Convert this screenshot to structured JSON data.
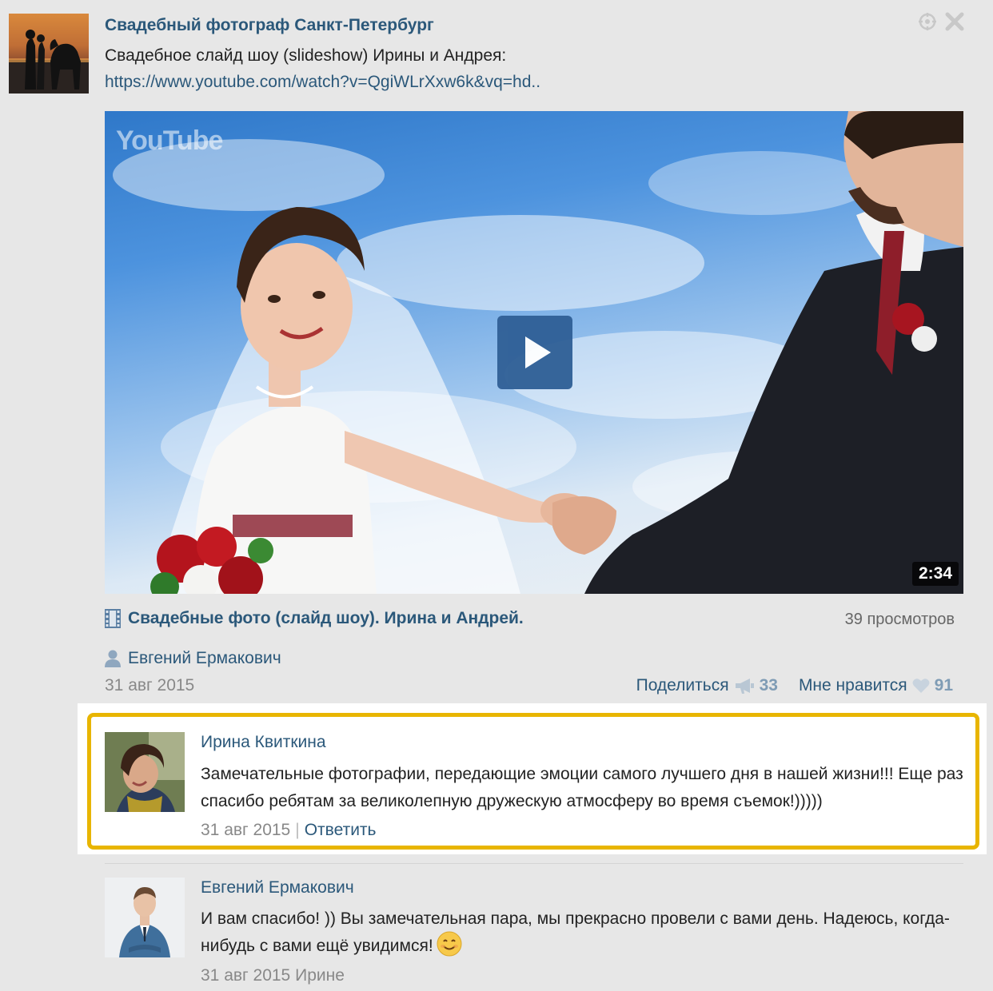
{
  "post": {
    "author": "Свадебный фотограф Санкт-Петербург",
    "text": "Свадебное слайд шоу (slideshow) Ирины и Андрея:",
    "url": "https://www.youtube.com/watch?v=QgiWLrXxw6k&vq=hd..",
    "date": "31 авг 2015",
    "header_icons": [
      "crosshair-icon",
      "close-icon"
    ]
  },
  "video": {
    "watermark": "YouTube",
    "duration": "2:34",
    "title": "Свадебные фото (слайд шоу). Ирина и Андрей.",
    "views": "39 просмотров",
    "owner": "Евгений Ермакович",
    "icons": [
      "film-icon",
      "play-icon",
      "user-icon"
    ]
  },
  "actions": {
    "share_label": "Поделиться",
    "share_count": "33",
    "like_label": "Мне нравится",
    "like_count": "91",
    "icons": [
      "megaphone-icon",
      "heart-icon"
    ]
  },
  "comments": [
    {
      "author": "Ирина Квиткина",
      "text": "Замечательные фотографии, передающие эмоции самого лучшего дня в нашей жизни!!! Еще раз спасибо ребятам за великолепную дружескую атмосферу во время съемок!)))))",
      "date": "31 авг 2015",
      "separator": "|",
      "reply_label": "Ответить",
      "highlight_color": "#e8b500"
    },
    {
      "author": "Евгений Ермакович",
      "text": "И вам спасибо! )) Вы замечательная пара, мы прекрасно провели с вами день. Надеюсь, когда-нибудь с вами ещё увидимся!",
      "emoji": "smile-emoji",
      "date": "31 авг 2015",
      "reply_to": "Ирине"
    }
  ],
  "colors": {
    "link": "#2b587a",
    "background": "#e7e7e7",
    "muted": "#888888",
    "count": "#7f9cb5"
  }
}
